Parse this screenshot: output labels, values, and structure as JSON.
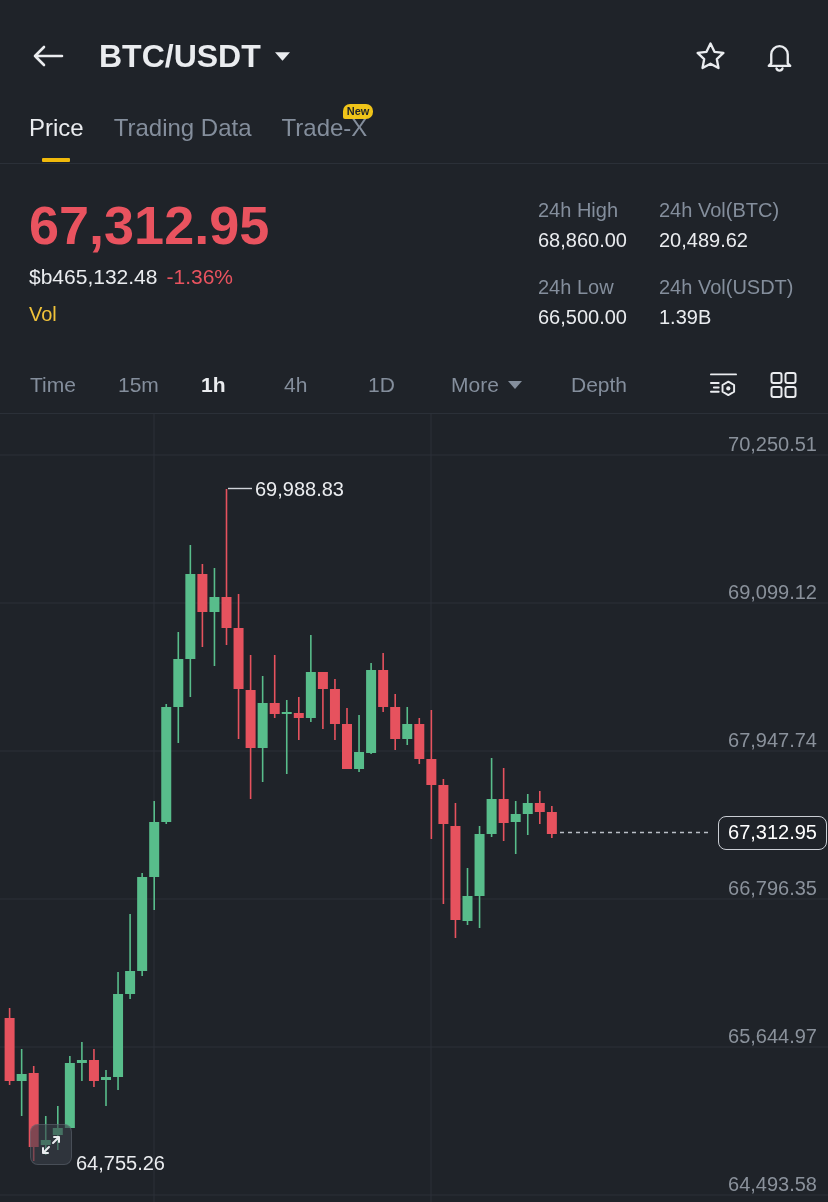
{
  "header": {
    "title": "BTC/USDT"
  },
  "tabs": [
    {
      "label": "Price",
      "selected": true
    },
    {
      "label": "Trading Data",
      "selected": false
    },
    {
      "label": "Trade-X",
      "selected": false,
      "badge": "New"
    }
  ],
  "price": {
    "last": "67,312.95",
    "falling": true,
    "fiat": "$b465,132.48",
    "change": "-1.36%",
    "vol_label": "Vol"
  },
  "stats": [
    {
      "label": "24h High",
      "value": "68,860.00"
    },
    {
      "label": "24h Vol(BTC)",
      "value": "20,489.62"
    },
    {
      "label": "24h Low",
      "value": "66,500.00"
    },
    {
      "label": "24h Vol(USDT)",
      "value": "1.39B"
    }
  ],
  "intervals": [
    {
      "label": "Time",
      "kind": "option",
      "selected": false
    },
    {
      "label": "15m",
      "kind": "option",
      "selected": false
    },
    {
      "label": "1h",
      "kind": "option",
      "selected": true
    },
    {
      "label": "4h",
      "kind": "option",
      "selected": false
    },
    {
      "label": "1D",
      "kind": "option",
      "selected": false
    },
    {
      "label": "More",
      "kind": "dropdown",
      "selected": false
    },
    {
      "label": "Depth",
      "kind": "option",
      "selected": false
    }
  ],
  "chart": {
    "price_scale": [
      "70,250.51",
      "69,099.12",
      "67,947.74",
      "66,796.35",
      "65,644.97",
      "64,493.58"
    ],
    "high_label": "69,988.83",
    "low_label": "64,755.26",
    "last_price_tag": "67,312.95"
  }
}
